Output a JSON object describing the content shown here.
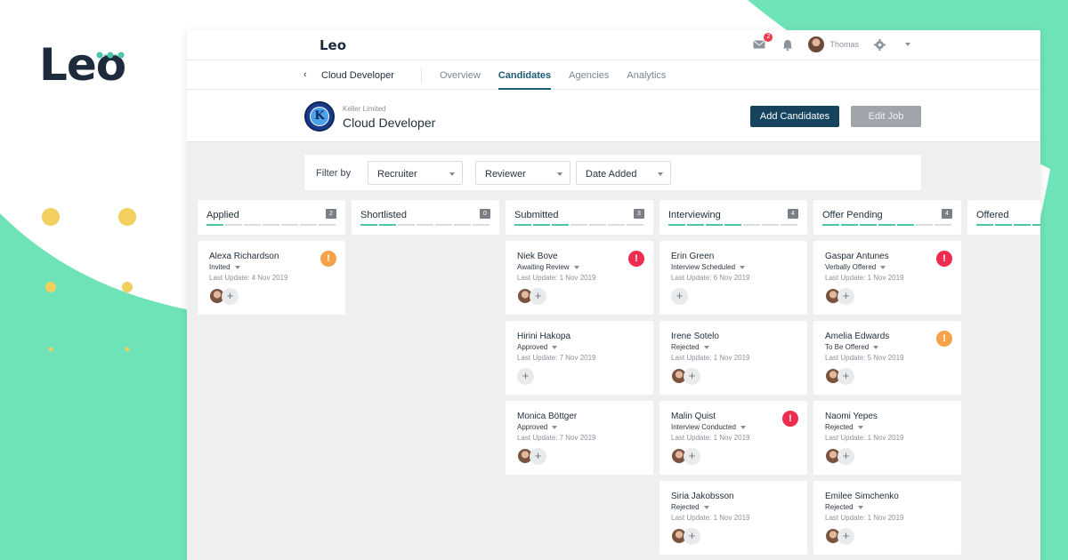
{
  "brand": {
    "logo_text": "Leo",
    "accent": "#6fe3b8",
    "dots_color": "#f2cf5e"
  },
  "app": {
    "logo_text": "Leo",
    "notifications_count": "2",
    "user_name": "Thomas",
    "icons": [
      "mail-icon",
      "bell-icon",
      "avatar",
      "gear-icon",
      "chevron-down-icon"
    ]
  },
  "subnav": {
    "back_icon": "‹",
    "job_title": "Cloud Developer",
    "tabs": [
      {
        "label": "Overview"
      },
      {
        "label": "Candidates"
      },
      {
        "label": "Agencies"
      },
      {
        "label": "Analytics"
      }
    ],
    "active_tab": "Candidates"
  },
  "header": {
    "company_name": "Keller Limited",
    "company_initial": "K",
    "title": "Cloud Developer",
    "add_button": "Add Candidates",
    "edit_button": "Edit Job"
  },
  "filter": {
    "label": "Filter by",
    "recruiter": "Recruiter",
    "reviewer": "Reviewer",
    "date_added": "Date Added"
  },
  "columns": [
    {
      "name": "Applied",
      "count": "2",
      "progress": 1,
      "cards": [
        {
          "name": "Alexa Richardson",
          "status": "Invited",
          "update": "Last Update: 4 Nov 2019",
          "alert": "warning",
          "has_avatar": true
        }
      ]
    },
    {
      "name": "Shortlisted",
      "count": "0",
      "progress": 2,
      "cards": []
    },
    {
      "name": "Submitted",
      "count": "3",
      "progress": 3,
      "cards": [
        {
          "name": "Niek Bove",
          "status": "Awaiting Review",
          "update": "Last Update: 1 Nov 2019",
          "alert": "danger",
          "has_avatar": true
        },
        {
          "name": "Hirini Hakopa",
          "status": "Approved",
          "update": "Last Update: 7 Nov 2019",
          "alert": "",
          "has_avatar": false
        },
        {
          "name": "Monica Böttger",
          "status": "Approved",
          "update": "Last Update: 7 Nov 2019",
          "alert": "",
          "has_avatar": true
        }
      ]
    },
    {
      "name": "Interviewing",
      "count": "4",
      "progress": 4,
      "cards": [
        {
          "name": "Erin Green",
          "status": "Interview Scheduled",
          "update": "Last Update: 6 Nov 2019",
          "alert": "",
          "has_avatar": false
        },
        {
          "name": "Irene Sotelo",
          "status": "Rejected",
          "update": "Last Update: 1 Nov 2019",
          "alert": "",
          "has_avatar": true
        },
        {
          "name": "Malin Quist",
          "status": "Interview Conducted",
          "update": "Last Update: 1 Nov 2019",
          "alert": "danger",
          "has_avatar": true
        },
        {
          "name": "Siria Jakobsson",
          "status": "Rejected",
          "update": "Last Update: 1 Nov 2019",
          "alert": "",
          "has_avatar": true
        }
      ]
    },
    {
      "name": "Offer Pending",
      "count": "4",
      "progress": 5,
      "cards": [
        {
          "name": "Gaspar Antunes",
          "status": "Verbally Offered",
          "update": "Last Update: 1 Nov 2019",
          "alert": "danger",
          "has_avatar": true
        },
        {
          "name": "Amelia Edwards",
          "status": "To Be Offered",
          "update": "Last Update: 5 Nov 2019",
          "alert": "warning",
          "has_avatar": true
        },
        {
          "name": "Naomi Yepes",
          "status": "Rejected",
          "update": "Last Update: 1 Nov 2019",
          "alert": "",
          "has_avatar": true
        },
        {
          "name": "Emilee Simchenko",
          "status": "Rejected",
          "update": "Last Update: 1 Nov 2019",
          "alert": "",
          "has_avatar": true
        }
      ]
    },
    {
      "name": "Offered",
      "count": "",
      "progress": 6,
      "cards": []
    }
  ],
  "colors": {
    "primary": "#16445e",
    "teal": "#4cc6ac",
    "danger": "#ec2d4f",
    "warning": "#f5a24a"
  }
}
